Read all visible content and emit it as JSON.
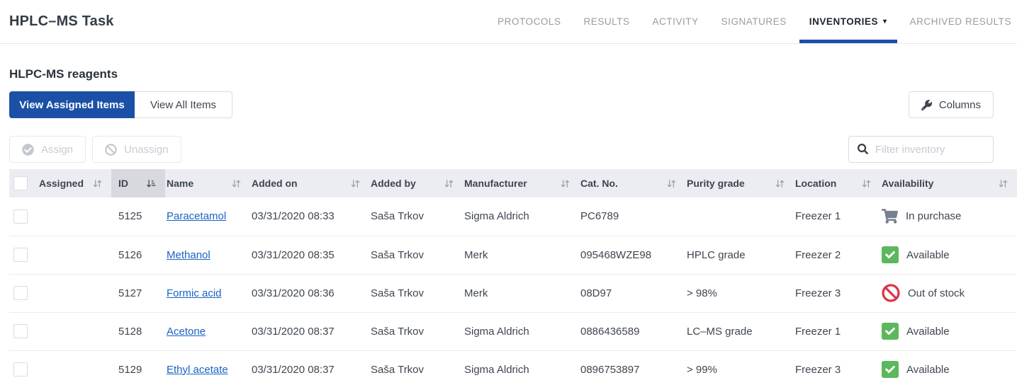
{
  "header": {
    "title": "HPLC–MS Task",
    "tabs": [
      {
        "label": "PROTOCOLS",
        "active": false
      },
      {
        "label": "RESULTS",
        "active": false
      },
      {
        "label": "ACTIVITY",
        "active": false
      },
      {
        "label": "SIGNATURES",
        "active": false
      },
      {
        "label": "INVENTORIES",
        "active": true,
        "caret": "▾"
      },
      {
        "label": "ARCHIVED RESULTS",
        "active": false
      }
    ]
  },
  "inventory": {
    "section_title": "HLPC-MS reagents",
    "view_assigned_label": "View Assigned Items",
    "view_all_label": "View All Items",
    "columns_button_label": "Columns",
    "assign_button_label": "Assign",
    "unassign_button_label": "Unassign",
    "filter_placeholder": "Filter inventory"
  },
  "table": {
    "columns": [
      "Assigned",
      "ID",
      "Name",
      "Added on",
      "Added by",
      "Manufacturer",
      "Cat. No.",
      "Purity grade",
      "Location",
      "Availability"
    ],
    "sorted_column": "ID",
    "sort_direction": "ascending",
    "rows": [
      {
        "assigned": true,
        "id": "5125",
        "name": "Paracetamol",
        "added_on": "03/31/2020 08:33",
        "added_by": "Saša Trkov",
        "manufacturer": "Sigma Aldrich",
        "cat_no": "PC6789",
        "purity": "",
        "location": "Freezer 1",
        "availability": {
          "text": "In purchase",
          "icon": "cart"
        }
      },
      {
        "assigned": true,
        "id": "5126",
        "name": "Methanol",
        "added_on": "03/31/2020 08:35",
        "added_by": "Saša Trkov",
        "manufacturer": "Merk",
        "cat_no": "095468WZE98",
        "purity": "HPLC grade",
        "location": "Freezer 2",
        "availability": {
          "text": "Available",
          "icon": "check"
        }
      },
      {
        "assigned": true,
        "id": "5127",
        "name": "Formic acid",
        "added_on": "03/31/2020 08:36",
        "added_by": "Saša Trkov",
        "manufacturer": "Merk",
        "cat_no": "08D97",
        "purity": "> 98%",
        "location": "Freezer 3",
        "availability": {
          "text": "Out of stock",
          "icon": "ban"
        }
      },
      {
        "assigned": true,
        "id": "5128",
        "name": "Acetone",
        "added_on": "03/31/2020 08:37",
        "added_by": "Saša Trkov",
        "manufacturer": "Sigma Aldrich",
        "cat_no": "0886436589",
        "purity": "LC–MS grade",
        "location": "Freezer 1",
        "availability": {
          "text": "Available",
          "icon": "check"
        }
      },
      {
        "assigned": true,
        "id": "5129",
        "name": "Ethyl acetate",
        "added_on": "03/31/2020 08:37",
        "added_by": "Saša Trkov",
        "manufacturer": "Sigma Aldrich",
        "cat_no": "0896753897",
        "purity": "> 99%",
        "location": "Freezer 3",
        "availability": {
          "text": "Available",
          "icon": "check"
        }
      }
    ]
  },
  "colors": {
    "accent_blue": "#1B50A6",
    "link_blue": "#1A64C4",
    "available_green": "#5CB85C",
    "out_of_stock_red": "#DC3545",
    "in_purchase_gray": "#75818E",
    "table_header_bg": "#ECEDF2",
    "sorted_column_bg": "#D8D9DE"
  }
}
